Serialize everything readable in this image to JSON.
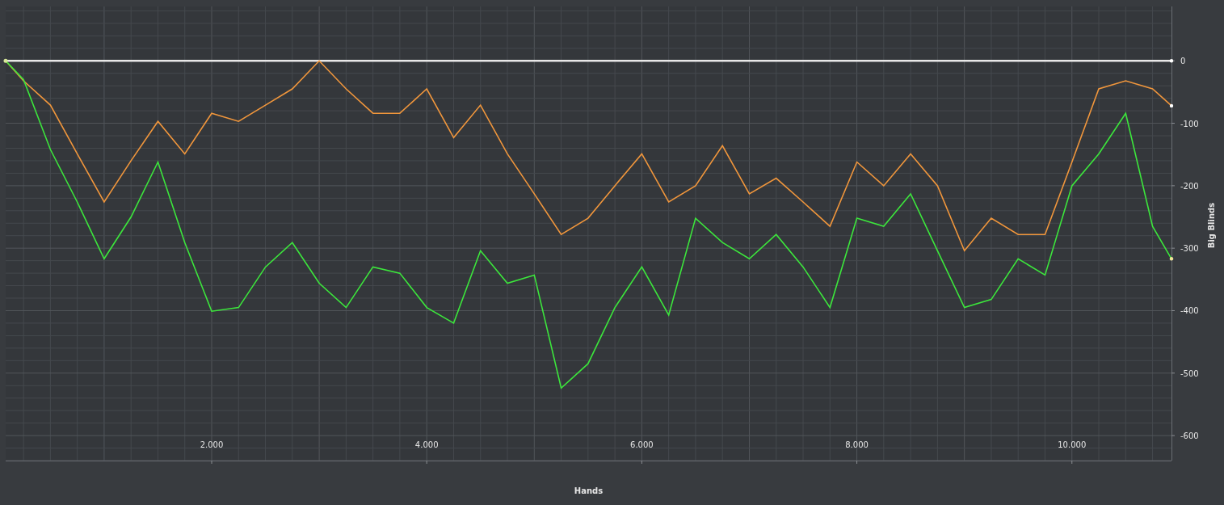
{
  "chart_data": {
    "type": "line",
    "grid": true,
    "xlabel": "Hands",
    "ylabel": "Big Blinds",
    "x": [
      84,
      250,
      500,
      750,
      1000,
      1250,
      1500,
      1750,
      2000,
      2250,
      2500,
      2750,
      3000,
      3250,
      3500,
      3750,
      4000,
      4250,
      4500,
      4750,
      5000,
      5250,
      5500,
      5750,
      6000,
      6250,
      6500,
      6750,
      7000,
      7250,
      7500,
      7750,
      8000,
      8250,
      8500,
      8750,
      9000,
      9250,
      9500,
      9750,
      10000,
      10250,
      10500,
      10750,
      10926
    ],
    "series": [
      {
        "color": "#e8e8e8",
        "values": [
          0,
          0,
          0,
          0,
          0,
          0,
          0,
          0,
          0,
          0,
          0,
          0,
          0,
          0,
          0,
          0,
          0,
          0,
          0,
          0,
          0,
          0,
          0,
          0,
          0,
          0,
          0,
          0,
          0,
          0,
          0,
          0,
          0,
          0,
          0,
          0,
          0,
          0,
          0,
          0,
          0,
          0,
          0,
          0,
          0
        ]
      },
      {
        "color": "#f0963c",
        "values": [
          0,
          -32,
          -71,
          -149,
          -226,
          -160,
          -97,
          -149,
          -84,
          -97,
          -71,
          -45,
          0,
          -45,
          -84,
          -84,
          -45,
          -123,
          -71,
          -149,
          -213,
          -278,
          -252,
          -200,
          -149,
          -226,
          -200,
          -136,
          -213,
          -188,
          -226,
          -265,
          -162,
          -200,
          -149,
          -200,
          -304,
          -252,
          -278,
          -278,
          -162,
          -45,
          -32,
          -45,
          -72
        ]
      },
      {
        "color": "#3ce63c",
        "values": [
          0,
          -30,
          -142,
          -226,
          -317,
          -250,
          -162,
          -291,
          -401,
          -395,
          -330,
          -291,
          -356,
          -395,
          -330,
          -340,
          -395,
          -420,
          -304,
          -356,
          -343,
          -524,
          -485,
          -395,
          -330,
          -407,
          -252,
          -291,
          -317,
          -278,
          -330,
          -395,
          -252,
          -265,
          -213,
          -304,
          -395,
          -382,
          -317,
          -343,
          -200,
          -149,
          -84,
          -265,
          -317
        ]
      }
    ],
    "xlim": [
      84,
      10926
    ],
    "ylim": [
      -640,
      87
    ],
    "xticks": [
      {
        "value": 2000,
        "label": "2.000"
      },
      {
        "value": 4000,
        "label": "4.000"
      },
      {
        "value": 6000,
        "label": "6.000"
      },
      {
        "value": 8000,
        "label": "8.000"
      },
      {
        "value": 10000,
        "label": "10.000"
      }
    ],
    "yticks": [
      0,
      -100,
      -200,
      -300,
      -400,
      -500,
      -600
    ]
  }
}
